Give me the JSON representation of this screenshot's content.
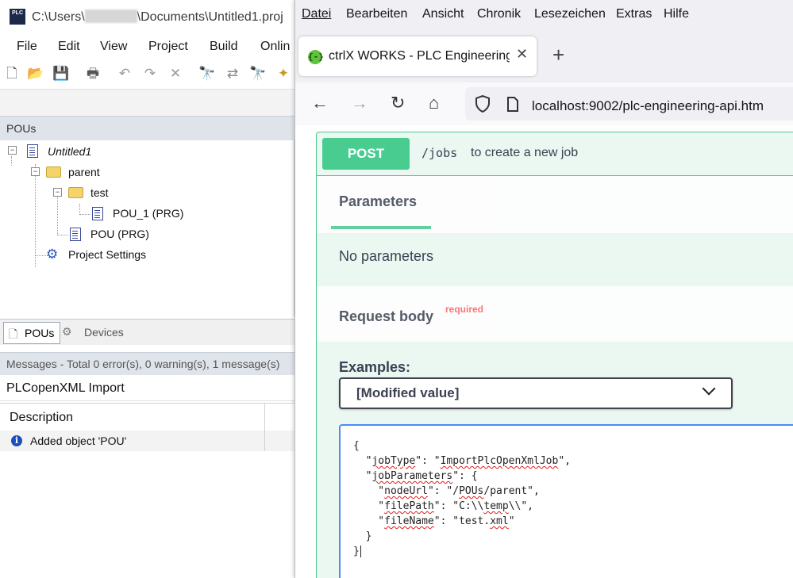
{
  "ide": {
    "title_prefix": "C:\\Users\\",
    "title_suffix": "\\Documents\\Untitled1.proj",
    "logo_text": "PLC",
    "menu": [
      "File",
      "Edit",
      "View",
      "Project",
      "Build",
      "Onlin"
    ],
    "toolbar_icons": [
      "new-icon",
      "open-icon",
      "save-icon",
      "print-icon",
      "undo-icon",
      "redo-icon",
      "delete-icon",
      "find-icon",
      "replace-icon",
      "find-next-icon",
      "bookmark-icon"
    ],
    "pous_panel_title": "POUs",
    "tree": {
      "root": "Untitled1",
      "parent": "parent",
      "test": "test",
      "pou1": "POU_1 (PRG)",
      "pou": "POU (PRG)",
      "settings": "Project Settings"
    },
    "tabs": [
      "POUs",
      "Devices"
    ],
    "messages_header": "Messages - Total 0 error(s), 0 warning(s), 1 message(s)",
    "messages_filter": "PLCopenXML Import",
    "messages_column": "Description",
    "message_row": "Added object 'POU'"
  },
  "browser": {
    "menu": [
      "Datei",
      "Bearbeiten",
      "Ansicht",
      "Chronik",
      "Lesezeichen",
      "Extras",
      "Hilfe"
    ],
    "tab_title": "ctrlX WORKS - PLC Engineering",
    "tab_favicon": "{-}",
    "new_tab_label": "+",
    "url": "localhost:9002/plc-engineering-api.htm",
    "nav_icons": [
      "back-icon",
      "forward-icon",
      "reload-icon",
      "home-icon"
    ]
  },
  "api": {
    "method": "POST",
    "path": "/jobs",
    "description": "to create a new job",
    "parameters_tab": "Parameters",
    "no_parameters": "No parameters",
    "request_body_title": "Request body",
    "required_label": "required",
    "examples_label": "Examples:",
    "examples_selected": "[Modified value]",
    "body_lines": [
      "{",
      "  \"jobType\": \"ImportPlcOpenXmlJob\",",
      "  \"jobParameters\": {",
      "    \"nodeUrl\": \"/POUs/parent\",",
      "    \"filePath\": \"C:\\\\temp\\\\\",",
      "    \"fileName\": \"test.xml\"",
      "  }",
      "}"
    ]
  },
  "colors": {
    "post_green": "#49cc90",
    "post_bg": "#ebf7f1",
    "required_red": "#ff6060",
    "editor_border": "#4c8bf5"
  }
}
